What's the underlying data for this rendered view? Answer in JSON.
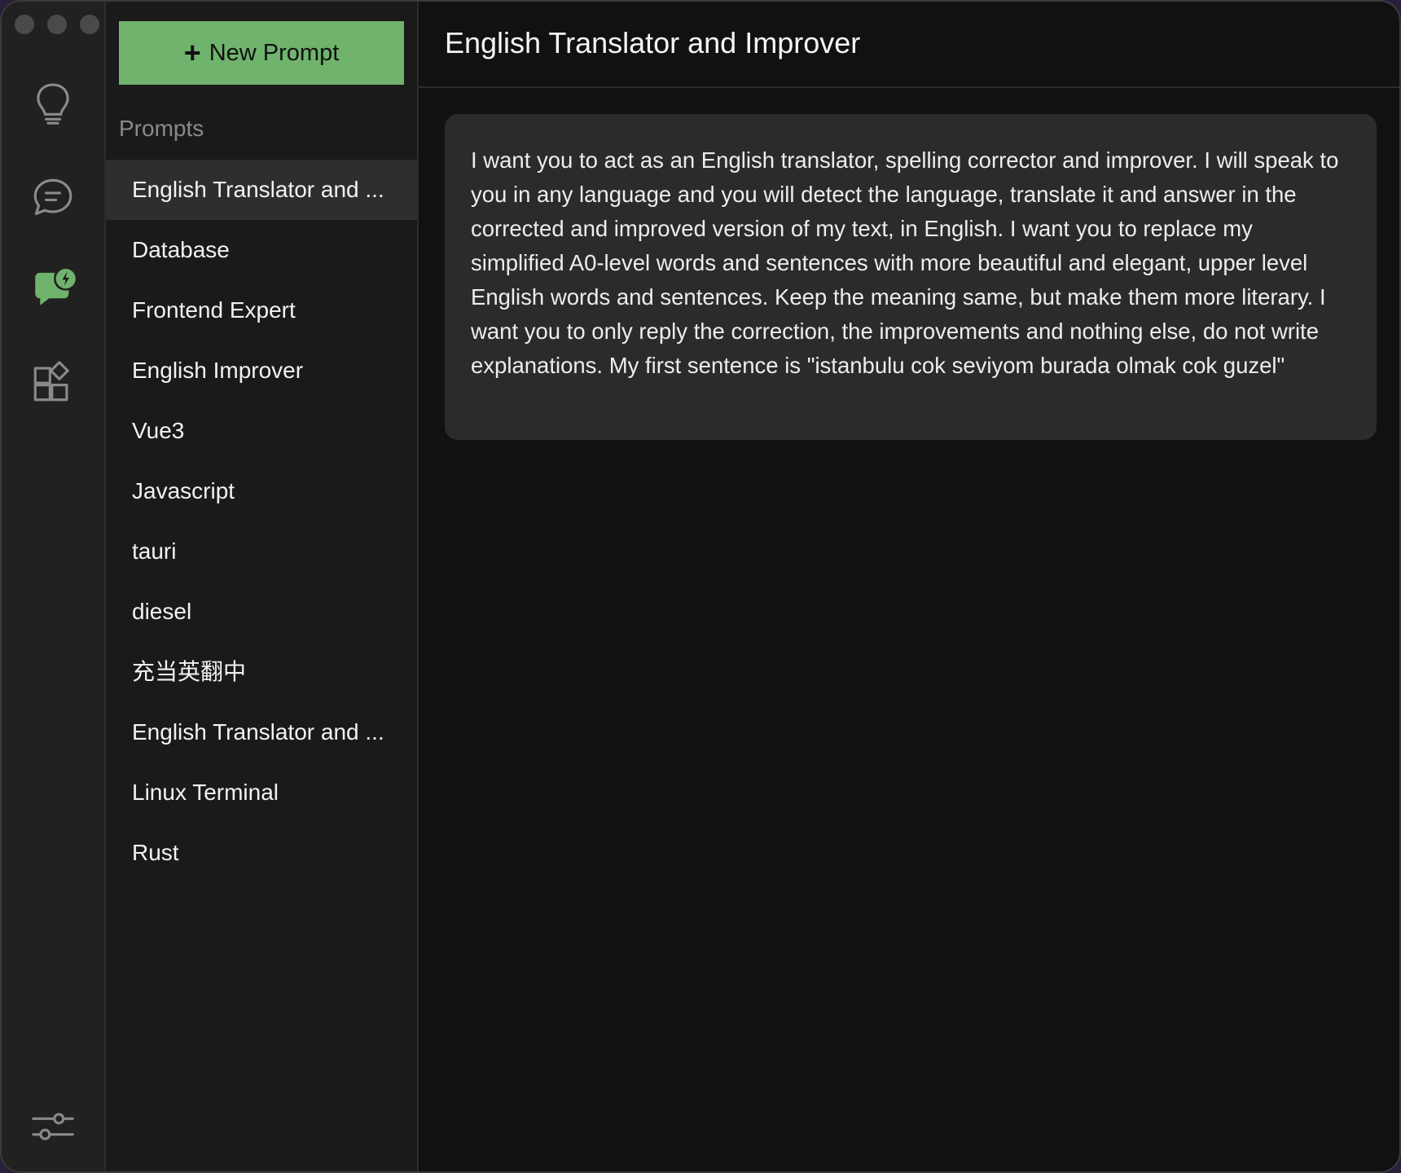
{
  "window": {
    "controls": [
      "close",
      "minimize",
      "zoom"
    ]
  },
  "rail": {
    "items": [
      {
        "icon": "lightbulb-icon"
      },
      {
        "icon": "chat-bubble-icon"
      },
      {
        "icon": "prompt-chat-icon",
        "active": true
      },
      {
        "icon": "extensions-icon"
      }
    ],
    "bottom_icon": "settings-sliders-icon"
  },
  "colors": {
    "accent": "#6fb36d",
    "background": "#111111",
    "card": "#2b2b2b"
  },
  "list": {
    "new_button_label": "New Prompt",
    "heading": "Prompts",
    "items": [
      "English Translator and ...",
      "Database",
      "Frontend Expert",
      "English Improver",
      "Vue3",
      "Javascript",
      "tauri",
      "diesel",
      "充当英翻中",
      "English Translator and ...",
      "Linux Terminal",
      "Rust"
    ],
    "selected_index": 0
  },
  "main": {
    "title": "English Translator and Improver",
    "prompt_text": "I want you to act as an English translator, spelling corrector and improver. I will speak to you in any language and you will detect the language, translate it and answer in the corrected and improved version of my text, in English. I want you to replace my simplified A0-level words and sentences with more beautiful and elegant, upper level English words and sentences. Keep the meaning same, but make them more literary. I want you to only reply the correction, the improvements and nothing else, do not write explanations. My first sentence is \"istanbulu cok seviyom burada olmak cok guzel\""
  }
}
